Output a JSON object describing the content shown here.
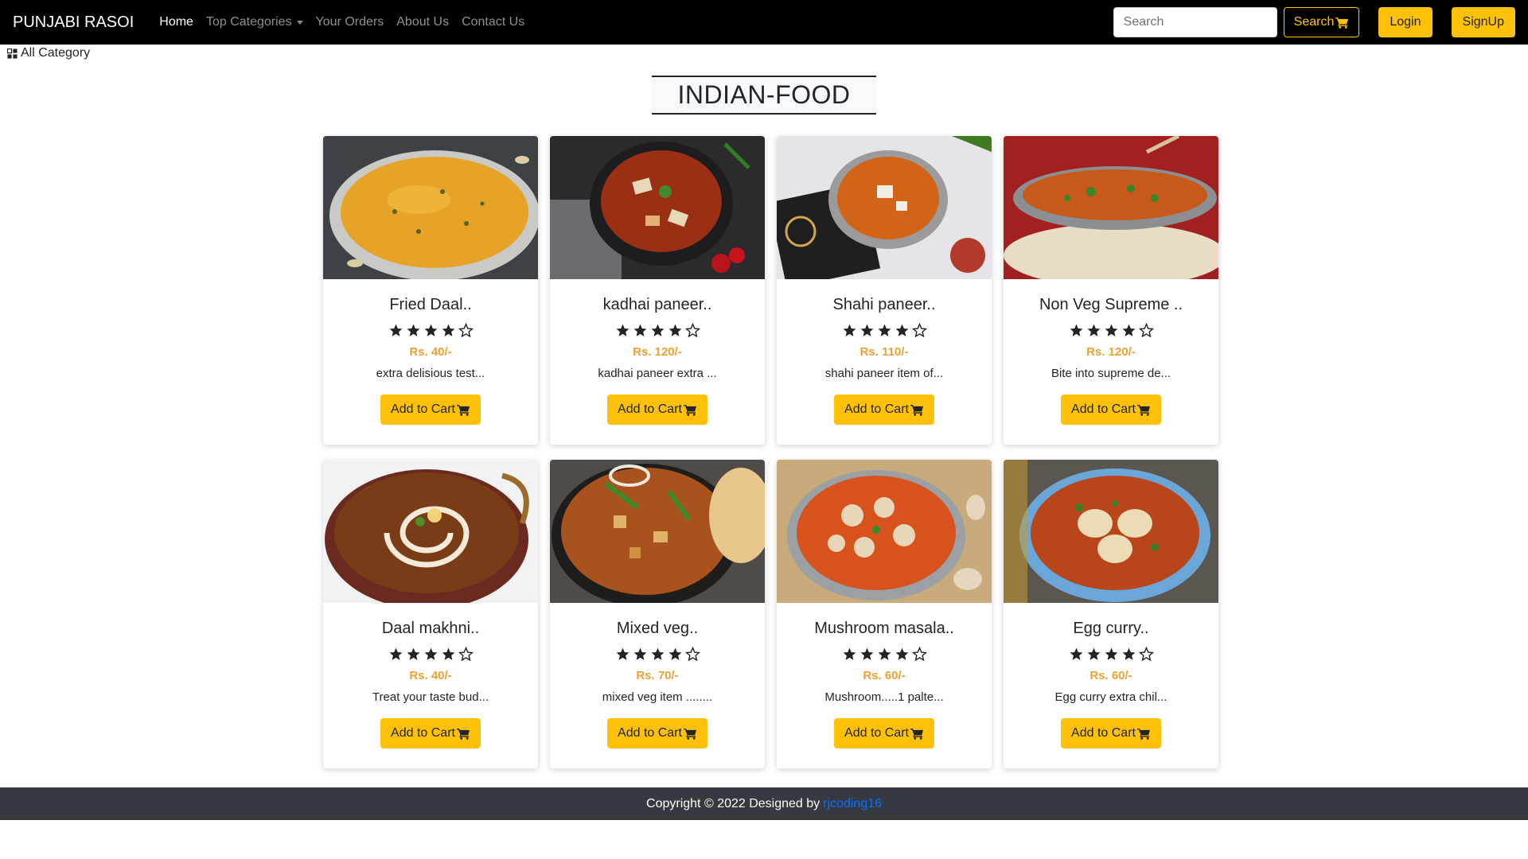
{
  "navbar": {
    "brand": "PUNJABI RASOI",
    "links": [
      {
        "label": "Home",
        "active": true
      },
      {
        "label": "Top Categories",
        "dropdown": true
      },
      {
        "label": "Your Orders"
      },
      {
        "label": "About Us"
      },
      {
        "label": "Contact Us"
      }
    ],
    "search_placeholder": "Search",
    "search_button": "Search",
    "login": "Login",
    "signup": "SignUp"
  },
  "all_category": "All Category",
  "page_title": "INDIAN-FOOD",
  "rating_stars": 4,
  "rating_max": 5,
  "add_to_cart": "Add to Cart",
  "products": [
    {
      "name": "Fried Daal..",
      "price": "Rs. 40/-",
      "desc": "extra delisious test...",
      "image": "yellow-daal-bowl"
    },
    {
      "name": "kadhai paneer..",
      "price": "Rs. 120/-",
      "desc": "kadhai paneer extra ...",
      "image": "kadhai-paneer-bowl"
    },
    {
      "name": "Shahi paneer..",
      "price": "Rs. 110/-",
      "desc": "shahi paneer item of...",
      "image": "shahi-paneer-bowl"
    },
    {
      "name": "Non Veg Supreme ..",
      "price": "Rs. 120/-",
      "desc": "Bite into supreme de...",
      "image": "curry-with-naan"
    },
    {
      "name": "Daal makhni..",
      "price": "Rs. 40/-",
      "desc": "Treat your taste bud...",
      "image": "daal-makhni-kadai"
    },
    {
      "name": "Mixed veg..",
      "price": "Rs. 70/-",
      "desc": "mixed veg item ........",
      "image": "mixed-veg-pan"
    },
    {
      "name": "Mushroom masala..",
      "price": "Rs. 60/-",
      "desc": "Mushroom.....1 palte...",
      "image": "mushroom-masala-bowl"
    },
    {
      "name": "Egg curry..",
      "price": "Rs. 60/-",
      "desc": "Egg curry extra chil...",
      "image": "egg-curry-bowl"
    }
  ],
  "footer": {
    "text": "Copyright © 2022 Designed by",
    "link": "rjcoding16"
  },
  "colors": {
    "navbar_bg": "#000000",
    "accent": "#ffc107",
    "price": "#f0a030",
    "footer_bg": "#343a40",
    "link": "#0d6efd"
  }
}
